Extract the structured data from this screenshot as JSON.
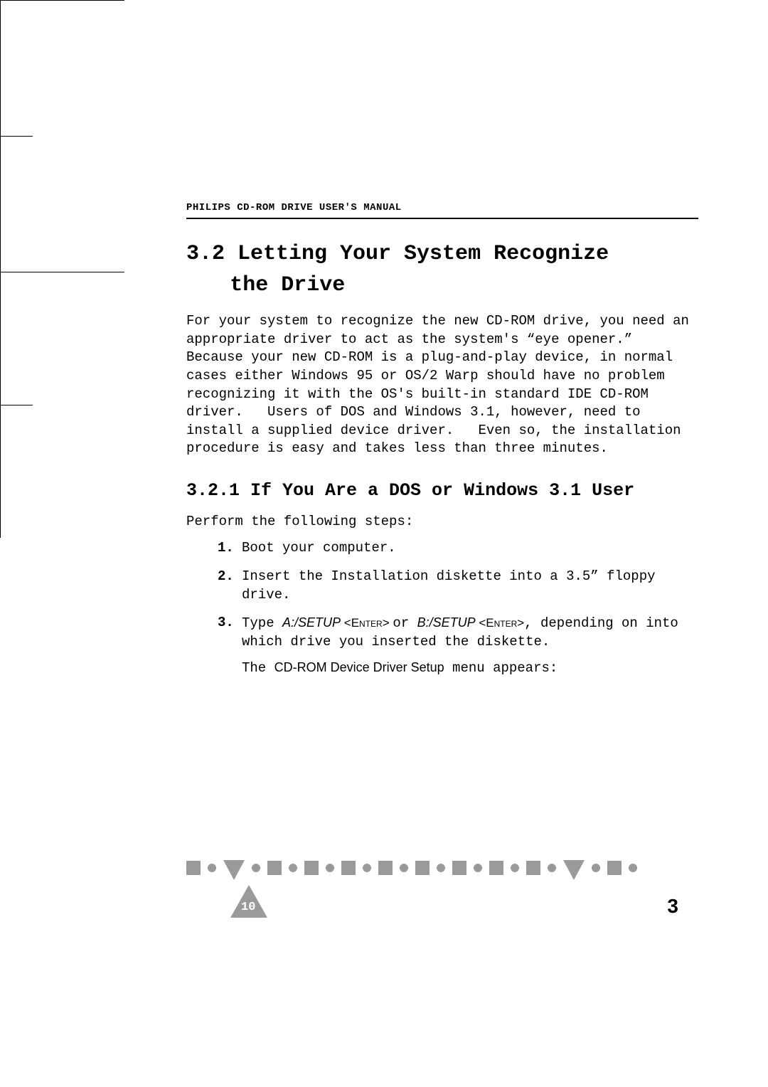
{
  "header": {
    "running_head": "PHILIPS CD-ROM DRIVE USER'S MANUAL"
  },
  "section": {
    "h1_line1": "3.2 Letting Your System Recognize",
    "h1_line2": "the Drive",
    "intro": "For your system to recognize the new CD-ROM drive, you need an appropriate driver to act as the system's “eye opener.”  Because your new CD-ROM is a plug-and-play device, in normal cases either Windows 95 or OS/2 Warp should have no problem recognizing it with the OS's built-in standard IDE CD-ROM driver.   Users of DOS and Windows 3.1, however, need to install a supplied device driver.   Even so, the installation procedure is easy and takes less than three minutes."
  },
  "subsection": {
    "h2": "3.2.1 If You Are a DOS or Windows 3.1 User",
    "lead": "Perform the following steps:"
  },
  "steps": {
    "s1": {
      "num": "1.",
      "text": "Boot your computer."
    },
    "s2": {
      "num": "2.",
      "text": "Insert the Installation diskette into a 3.5” floppy drive."
    },
    "s3": {
      "num": "3.",
      "pre": "Type ",
      "cmd_a": "A:/SETUP",
      "enter_a": " <Enter> ",
      "or": "or ",
      "cmd_b": "B:/SETUP",
      "enter_b": " <Enter>",
      "post": ", depending on into which drive you inserted the diskette.",
      "sub_pre": "The ",
      "sub_label": "CD-ROM Device Driver Setup",
      "sub_post": " menu appears:"
    }
  },
  "footer": {
    "page_number": "10",
    "chapter_number": "3"
  }
}
